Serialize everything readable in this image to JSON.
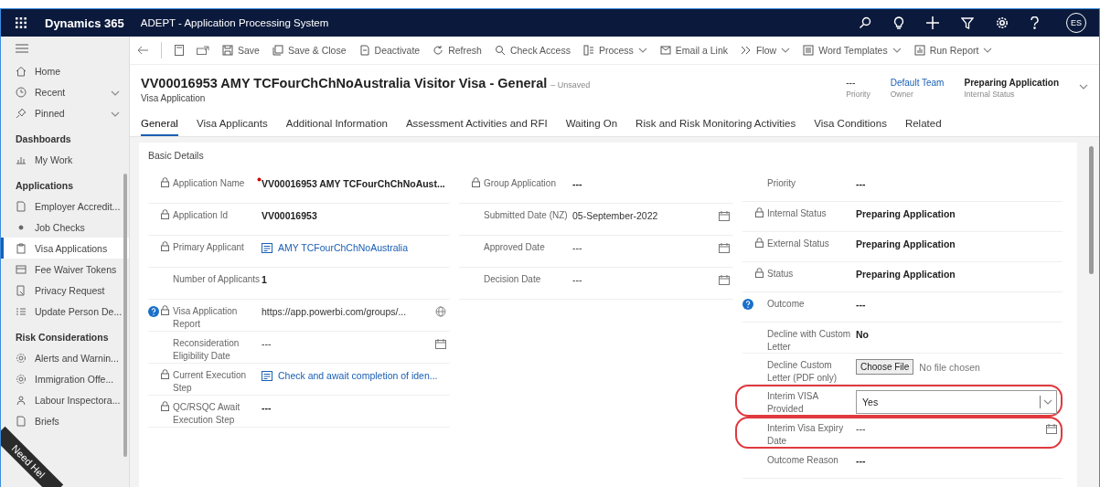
{
  "app_bar": {
    "brand": "Dynamics 365",
    "app_name": "ADEPT - Application Processing System",
    "avatar_initials": "ES"
  },
  "sidebar": {
    "top_items": [
      {
        "label": "Home",
        "expandable": false
      },
      {
        "label": "Recent",
        "expandable": true
      },
      {
        "label": "Pinned",
        "expandable": true
      }
    ],
    "sections": [
      {
        "title": "Dashboards",
        "items": [
          {
            "label": "My Work",
            "selected": false
          }
        ]
      },
      {
        "title": "Applications",
        "items": [
          {
            "label": "Employer Accredit...",
            "selected": false
          },
          {
            "label": "Job Checks",
            "selected": false
          },
          {
            "label": "Visa Applications",
            "selected": true
          },
          {
            "label": "Fee Waiver Tokens",
            "selected": false
          },
          {
            "label": "Privacy Request",
            "selected": false
          },
          {
            "label": "Update Person De...",
            "selected": false
          }
        ]
      },
      {
        "title": "Risk Considerations",
        "items": [
          {
            "label": "Alerts and Warnin...",
            "selected": false
          },
          {
            "label": "Immigration Offe...",
            "selected": false
          },
          {
            "label": "Labour Inspectora...",
            "selected": false
          },
          {
            "label": "Briefs",
            "selected": false
          }
        ]
      }
    ],
    "help_ribbon": "Need Hel"
  },
  "command_bar": [
    {
      "label": "Save",
      "dropdown": false
    },
    {
      "label": "Save & Close",
      "dropdown": false
    },
    {
      "label": "Deactivate",
      "dropdown": false
    },
    {
      "label": "Refresh",
      "dropdown": false
    },
    {
      "label": "Check Access",
      "dropdown": false
    },
    {
      "label": "Process",
      "dropdown": true
    },
    {
      "label": "Email a Link",
      "dropdown": false
    },
    {
      "label": "Flow",
      "dropdown": true
    },
    {
      "label": "Word Templates",
      "dropdown": true
    },
    {
      "label": "Run Report",
      "dropdown": true
    }
  ],
  "record_header": {
    "title": "VV00016953 AMY TCFourChChNoAustralia Visitor Visa - General",
    "save_status": "– Unsaved",
    "entity": "Visa Application",
    "summary": [
      {
        "value": "---",
        "label": "Priority",
        "kind": "text"
      },
      {
        "value": "Default Team",
        "label": "Owner",
        "kind": "link"
      },
      {
        "value": "Preparing Application",
        "label": "Internal Status",
        "kind": "bold"
      }
    ]
  },
  "tabs": [
    {
      "label": "General",
      "selected": true
    },
    {
      "label": "Visa Applicants",
      "selected": false
    },
    {
      "label": "Additional Information",
      "selected": false
    },
    {
      "label": "Assessment Activities and RFI",
      "selected": false
    },
    {
      "label": "Waiting On",
      "selected": false
    },
    {
      "label": "Risk and Risk Monitoring Activities",
      "selected": false
    },
    {
      "label": "Visa Conditions",
      "selected": false
    },
    {
      "label": "Related",
      "selected": false
    }
  ],
  "form": {
    "section_title": "Basic Details",
    "columns": [
      [
        {
          "label": "Application Name",
          "value": "VV00016953 AMY TCFourChChNoAust...",
          "kind": "bold",
          "locked": true,
          "required": true,
          "info": false,
          "highlighted": false
        },
        {
          "label": "Application Id",
          "value": "VV00016953",
          "kind": "bold",
          "locked": true,
          "required": false,
          "info": false,
          "highlighted": false
        },
        {
          "label": "Primary Applicant",
          "value": "AMY TCFourChChNoAustralia",
          "kind": "link",
          "locked": true,
          "required": false,
          "info": false,
          "highlighted": false
        },
        {
          "label": "Number of Applicants",
          "value": "1",
          "kind": "bold",
          "locked": false,
          "required": false,
          "info": false,
          "highlighted": false
        },
        {
          "label": "Visa Application Report",
          "value": "https://app.powerbi.com/groups/...",
          "kind": "url",
          "locked": true,
          "required": false,
          "info": true,
          "highlighted": false
        },
        {
          "label": "Reconsideration Eligibility Date",
          "value": "---",
          "kind": "date",
          "locked": false,
          "required": false,
          "info": false,
          "highlighted": false
        },
        {
          "label": "Current Execution Step",
          "value": "Check and await completion of iden...",
          "kind": "link",
          "locked": true,
          "required": false,
          "info": false,
          "highlighted": false
        },
        {
          "label": "QC/RSQC Await Execution Step",
          "value": "---",
          "kind": "bold",
          "locked": true,
          "required": false,
          "info": false,
          "highlighted": false
        }
      ],
      [
        {
          "label": "Group Application",
          "value": "---",
          "kind": "bold",
          "locked": true,
          "required": false,
          "info": false,
          "highlighted": false
        },
        {
          "label": "Submitted Date (NZ)",
          "value": "05-September-2022",
          "kind": "date",
          "locked": false,
          "required": false,
          "info": false,
          "highlighted": false
        },
        {
          "label": "Approved Date",
          "value": "---",
          "kind": "date",
          "locked": false,
          "required": false,
          "info": false,
          "highlighted": false
        },
        {
          "label": "Decision Date",
          "value": "---",
          "kind": "date",
          "locked": false,
          "required": false,
          "info": false,
          "highlighted": false
        }
      ],
      [
        {
          "label": "Priority",
          "value": "---",
          "kind": "bold",
          "locked": false,
          "required": false,
          "info": false,
          "highlighted": false
        },
        {
          "label": "Internal Status",
          "value": "Preparing Application",
          "kind": "bold",
          "locked": true,
          "required": false,
          "info": false,
          "highlighted": false
        },
        {
          "label": "External Status",
          "value": "Preparing Application",
          "kind": "bold",
          "locked": true,
          "required": false,
          "info": false,
          "highlighted": false
        },
        {
          "label": "Status",
          "value": "Preparing Application",
          "kind": "bold",
          "locked": true,
          "required": false,
          "info": false,
          "highlighted": false
        },
        {
          "label": "Outcome",
          "value": "---",
          "kind": "bold",
          "locked": false,
          "required": false,
          "info": true,
          "highlighted": false
        },
        {
          "label": "Decline with Custom Letter",
          "value": "No",
          "kind": "bold",
          "locked": false,
          "required": false,
          "info": false,
          "highlighted": false
        },
        {
          "label": "Decline Custom Letter (PDF only)",
          "value": "No file chosen",
          "button": "Choose File",
          "kind": "file",
          "locked": false,
          "required": false,
          "info": false,
          "highlighted": false
        },
        {
          "label": "Interim VISA Provided",
          "value": "Yes",
          "kind": "select",
          "locked": false,
          "required": false,
          "info": false,
          "highlighted": true
        },
        {
          "label": "Interim Visa Expiry Date",
          "value": "---",
          "kind": "date",
          "locked": false,
          "required": false,
          "info": false,
          "highlighted": true
        },
        {
          "label": "Outcome Reason",
          "value": "---",
          "kind": "bold",
          "locked": false,
          "required": false,
          "info": false,
          "highlighted": false
        }
      ]
    ]
  }
}
